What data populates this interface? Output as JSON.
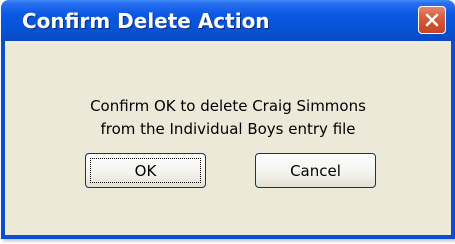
{
  "dialog": {
    "title": "Confirm Delete Action",
    "message_line1": "Confirm OK to delete Craig Simmons",
    "message_line2": "from the Individual Boys entry file",
    "ok_label": "OK",
    "cancel_label": "Cancel",
    "close_icon": "close-x-icon"
  },
  "colors": {
    "titlebar": "#0753d6",
    "window_body": "#ece9d8",
    "close_button": "#d55a3a"
  }
}
